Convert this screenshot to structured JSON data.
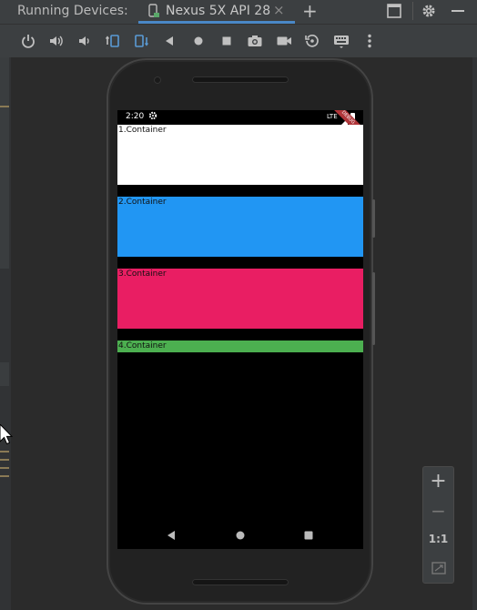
{
  "panel": {
    "title": "Running Devices:",
    "tab_label": "Nexus 5X API 28",
    "close_glyph": "×",
    "add_glyph": "+"
  },
  "toolbar": {
    "icons": [
      "power-icon",
      "volume-up-icon",
      "volume-down-icon",
      "rotate-left-icon",
      "rotate-right-icon",
      "back-icon",
      "home-icon",
      "overview-icon",
      "screenshot-icon",
      "screen-record-icon",
      "snapshot-icon",
      "keyboard-icon",
      "more-icon"
    ]
  },
  "phone": {
    "status_time": "2:20",
    "network": "LTE",
    "debug_banner": "DEBUG",
    "containers": [
      {
        "label": "1.Container",
        "color": "#ffffff"
      },
      {
        "label": "2.Container",
        "color": "#2196f3"
      },
      {
        "label": "3.Container",
        "color": "#e91e63"
      },
      {
        "label": "4.Container",
        "color": "#4caf50"
      }
    ]
  },
  "zoom": {
    "zoom_in": "+",
    "zoom_out": "−",
    "actual_size": "1:1"
  }
}
